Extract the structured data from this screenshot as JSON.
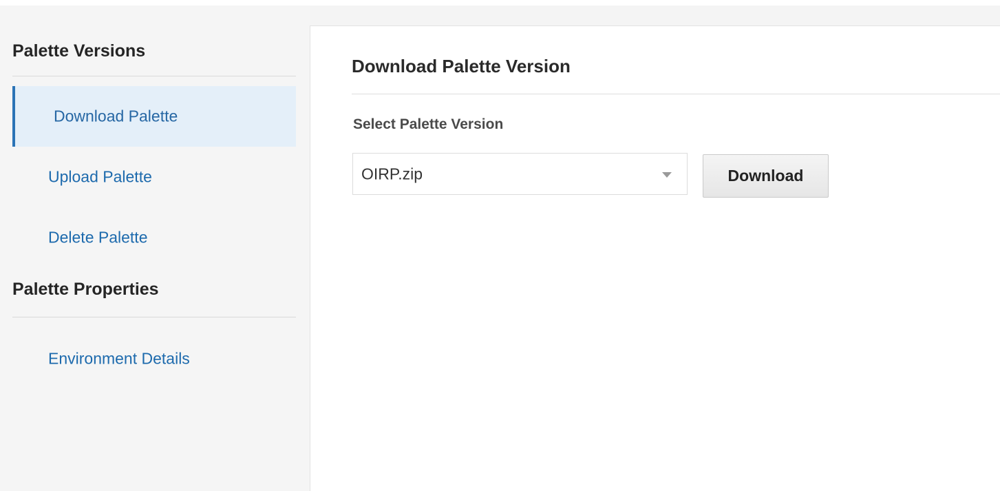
{
  "sidebar": {
    "sections": [
      {
        "title": "Palette Versions",
        "items": [
          {
            "label": "Download Palette",
            "selected": true
          },
          {
            "label": "Upload Palette",
            "selected": false
          },
          {
            "label": "Delete Palette",
            "selected": false
          }
        ]
      },
      {
        "title": "Palette Properties",
        "items": [
          {
            "label": "Environment Details",
            "selected": false
          }
        ]
      }
    ]
  },
  "main": {
    "title": "Download Palette Version",
    "field_label": "Select Palette Version",
    "select": {
      "value": "OIRP.zip",
      "icon": "chevron-down-icon"
    },
    "download_label": "Download"
  },
  "colors": {
    "accent": "#2b73b6",
    "link": "#1d6aad",
    "selected_bg": "#e4eff9"
  }
}
